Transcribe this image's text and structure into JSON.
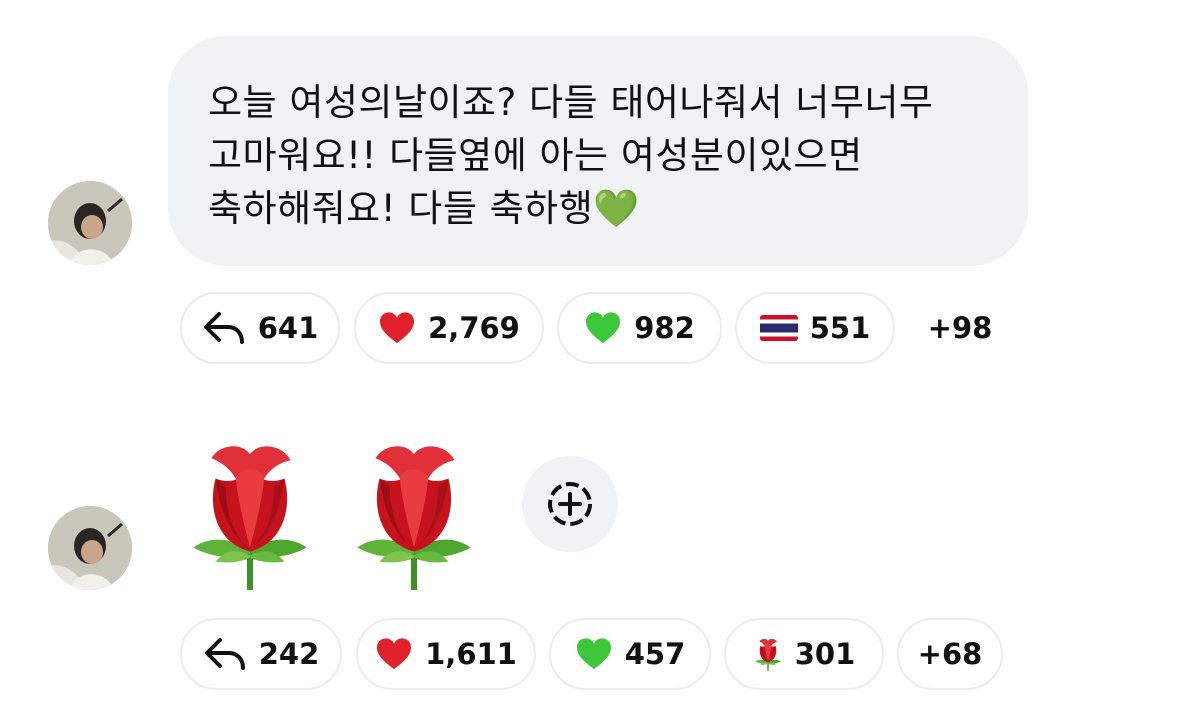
{
  "messages": [
    {
      "text": "오늘 여성의날이죠? 다들 태어나줘서 너무너무 고마워요!! 다들옆에 아는 여성분이있으면 축하해줘요! 다들 축하행💚",
      "reactions": {
        "reply_count": "641",
        "items": [
          {
            "icon": "red-heart",
            "count": "2,769"
          },
          {
            "icon": "green-heart",
            "count": "982"
          },
          {
            "icon": "thailand-flag",
            "count": "551"
          }
        ],
        "more": "+98"
      }
    },
    {
      "emoji": [
        "rose",
        "rose"
      ],
      "reactions": {
        "reply_count": "242",
        "items": [
          {
            "icon": "red-heart",
            "count": "1,611"
          },
          {
            "icon": "green-heart",
            "count": "457"
          },
          {
            "icon": "rose",
            "count": "301"
          }
        ],
        "more": "+68"
      }
    }
  ],
  "colors": {
    "bubble_bg": "#f1f2f4",
    "pill_border": "#ececef",
    "red_heart": "#e0202a",
    "green_heart": "#3cc83a"
  }
}
